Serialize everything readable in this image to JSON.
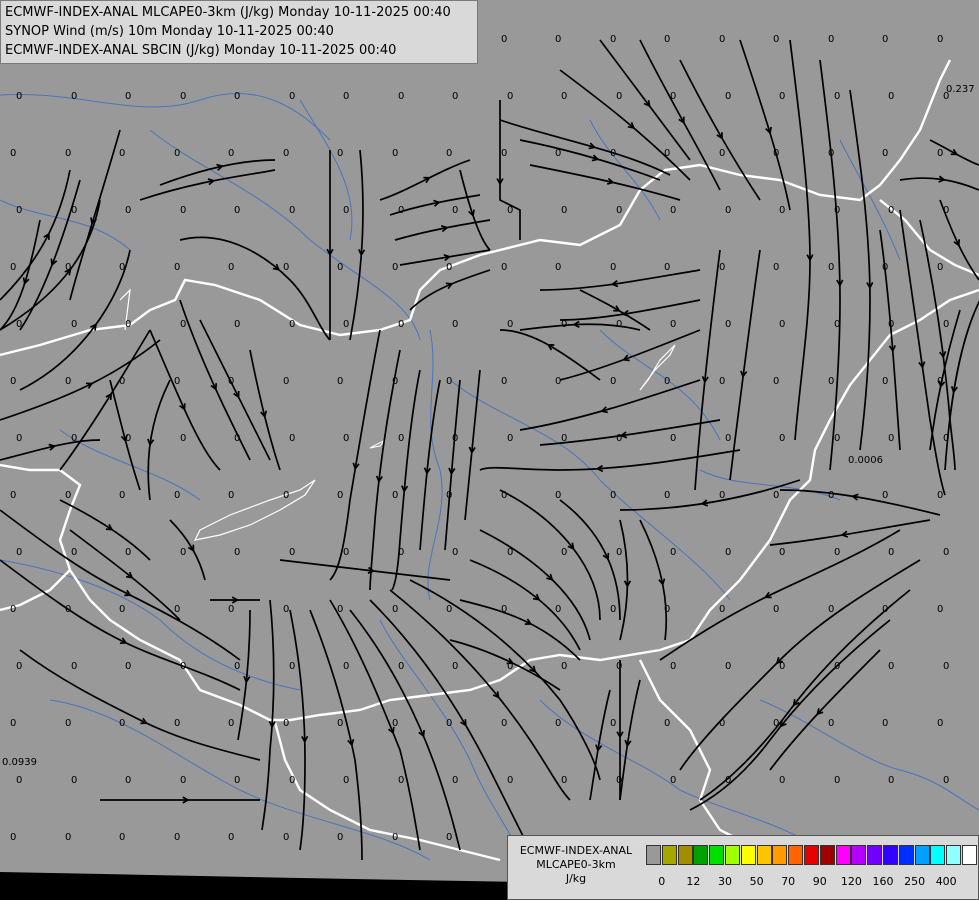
{
  "header": {
    "line1": "ECMWF-INDEX-ANAL MLCAPE0-3km (J/kg) Monday 10-11-2025 00:40",
    "line2": "SYNOP Wind (m/s) 10m Monday 10-11-2025 00:40",
    "line3": "ECMWF-INDEX-ANAL SBCIN (J/kg) Monday 10-11-2025 00:40"
  },
  "legend": {
    "line1": "ECMWF-INDEX-ANAL",
    "line2": "MLCAPE0-3km",
    "line3": "J/kg",
    "colors": [
      "#999999",
      "#a6a600",
      "#a38c00",
      "#00a000",
      "#00e000",
      "#a0ff00",
      "#ffff00",
      "#ffc400",
      "#ff9a00",
      "#ff6400",
      "#e60000",
      "#a00000",
      "#ff00ff",
      "#b400ff",
      "#7000ff",
      "#3000ff",
      "#0030ff",
      "#00a0ff",
      "#00ffff",
      "#90ffff",
      "#ffffff"
    ],
    "ticks": [
      "0",
      "12",
      "30",
      "50",
      "70",
      "90",
      "120",
      "160",
      "250",
      "400"
    ]
  },
  "annotations": [
    "0.237",
    "0.0006",
    "0.0939"
  ],
  "grid_value": "0"
}
